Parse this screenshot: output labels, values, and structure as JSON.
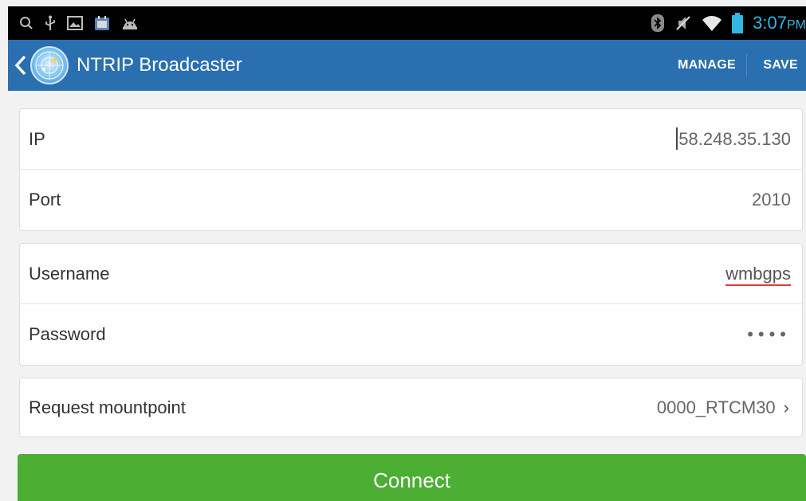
{
  "statusbar": {
    "left_icons": [
      "search-icon",
      "usb-icon",
      "gallery-icon",
      "calendar-icon",
      "android-icon"
    ],
    "right_icons": [
      "bluetooth-icon",
      "mute-icon",
      "wifi-icon",
      "battery-icon"
    ],
    "time": "3:07",
    "ampm": "PM",
    "clock_color": "#33b5e5"
  },
  "appbar": {
    "title": "NTRIP Broadcaster",
    "manage_label": "MANAGE",
    "save_label": "SAVE",
    "background": "#2a6fb0"
  },
  "server": {
    "ip_label": "IP",
    "ip_value": "58.248.35.130",
    "port_label": "Port",
    "port_value": "2010"
  },
  "account": {
    "username_label": "Username",
    "username_value": "wmbgps",
    "password_label": "Password",
    "password_value": "••••"
  },
  "mount": {
    "label": "Request mountpoint",
    "value": "0000_RTCM30"
  },
  "connect_label": "Connect",
  "accent_green": "#4caf34"
}
